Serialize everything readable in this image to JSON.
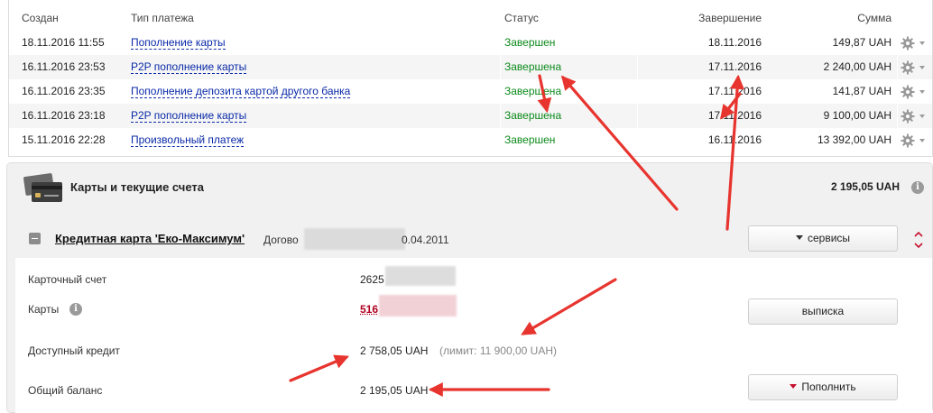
{
  "payments": {
    "columns": {
      "created": "Создан",
      "type": "Тип платежа",
      "status": "Статус",
      "completion": "Завершение",
      "amount": "Сумма"
    },
    "rows": [
      {
        "created": "18.11.2016 11:55",
        "type": "Пополнение карты",
        "status": "Завершен",
        "completion": "18.11.2016",
        "amount": "149,87 UAH"
      },
      {
        "created": "16.11.2016 23:53",
        "type": "P2P пополнение карты",
        "status": "Завершена",
        "completion": "17.11.2016",
        "amount": "2 240,00 UAH"
      },
      {
        "created": "16.11.2016 23:35",
        "type": "Пополнение депозита картой другого банка",
        "status": "Завершена",
        "completion": "17.11.2016",
        "amount": "141,87 UAH"
      },
      {
        "created": "16.11.2016 23:18",
        "type": "P2P пополнение карты",
        "status": "Завершена",
        "completion": "17.11.2016",
        "amount": "9 100,00 UAH"
      },
      {
        "created": "15.11.2016 22:28",
        "type": "Произвольный платеж",
        "status": "Завершен",
        "completion": "16.11.2016",
        "amount": "13 392,00 UAH"
      }
    ],
    "gear_icon": "gear-icon"
  },
  "cards": {
    "title": "Карты и текущие счета",
    "total": "2 195,05 UAH",
    "card": {
      "name": "Кредитная карта 'Еко-Максимум'",
      "contract_prefix": "Догово",
      "contract_date_suffix": "0.04.2011",
      "services_label": "сервисы",
      "statement_label": "выписка",
      "topup_label": "Пополнить",
      "account_label": "Карточный счет",
      "account_value": "2625",
      "cards_label": "Карты",
      "cards_value": "516",
      "available_label": "Доступный кредит",
      "available_value": "2 758,05 UAH",
      "limit_text": "(лимит: 11 900,00 UAH)",
      "balance_label": "Общий баланс",
      "balance_value": "2 195,05 UAH"
    }
  },
  "colors": {
    "status_green": "#0c8a1a",
    "link_blue": "#0a2aa8",
    "annotation_red": "#e8342e",
    "accent_red": "#c8102e"
  }
}
